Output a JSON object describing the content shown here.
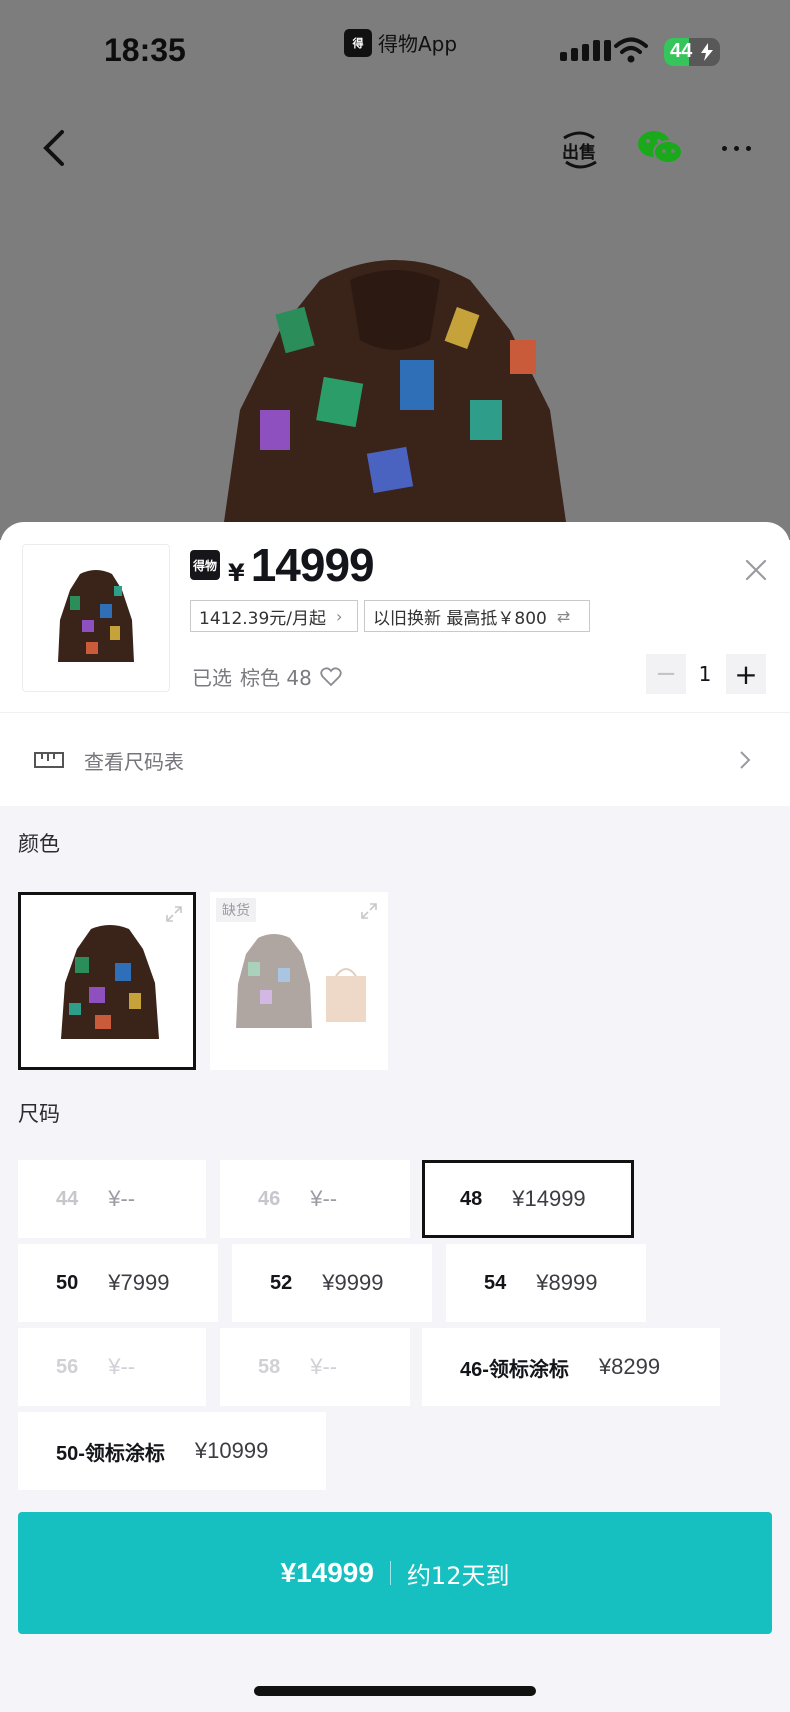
{
  "status_bar": {
    "time": "18:35",
    "app_name": "得物App",
    "battery": "44"
  },
  "top_nav": {
    "back_icon": "chevron-left-icon",
    "sell_label": "出售",
    "share_icon": "wechat-icon",
    "more_icon": "more-dots-icon"
  },
  "sheet": {
    "brand_logo": "得物",
    "currency": "¥",
    "price": "14999",
    "installment": "1412.39元/月起",
    "trade_in": "以旧换新 最高抵￥800",
    "selected_label": "已选",
    "selected_value": "棕色 48",
    "quantity": "1",
    "size_chart_label": "查看尺码表",
    "color_section_title": "颜色",
    "size_section_title": "尺码",
    "out_of_stock_badge": "缺货"
  },
  "colors": [
    {
      "name": "brown",
      "selected": true,
      "out_of_stock": false
    },
    {
      "name": "brown-with-bag",
      "selected": false,
      "out_of_stock": true
    }
  ],
  "sizes": [
    {
      "size": "44",
      "price": "¥--",
      "available": false
    },
    {
      "size": "46",
      "price": "¥--",
      "available": false
    },
    {
      "size": "48",
      "price": "¥14999",
      "available": true,
      "selected": true
    },
    {
      "size": "50",
      "price": "¥7999",
      "available": true
    },
    {
      "size": "52",
      "price": "¥9999",
      "available": true
    },
    {
      "size": "54",
      "price": "¥8999",
      "available": true
    },
    {
      "size": "56",
      "price": "¥--",
      "available": false
    },
    {
      "size": "58",
      "price": "¥--",
      "available": false
    },
    {
      "size": "46-领标涂标",
      "price": "¥8299",
      "available": true
    },
    {
      "size": "50-领标涂标",
      "price": "¥10999",
      "available": true
    }
  ],
  "buy_button": {
    "price": "¥14999",
    "eta": "约12天到",
    "color": "#16c0c0"
  }
}
